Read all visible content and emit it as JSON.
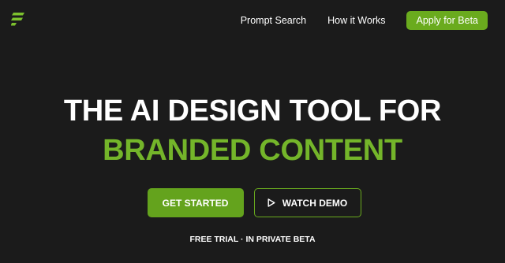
{
  "colors": {
    "background": "#1b1b1b",
    "accent": "#6aab1e",
    "accent_text": "#74b52a",
    "text": "#ffffff"
  },
  "header": {
    "logo_icon": "brand-logo-icon",
    "nav": [
      {
        "label": "Prompt Search"
      },
      {
        "label": "How it Works"
      }
    ],
    "cta_label": "Apply for Beta"
  },
  "hero": {
    "headline_line1": "THE AI DESIGN TOOL FOR",
    "headline_line2": "BRANDED CONTENT",
    "primary_button": "GET STARTED",
    "secondary_button": "WATCH DEMO",
    "secondary_icon": "play-icon",
    "note": "FREE TRIAL · IN PRIVATE BETA"
  }
}
